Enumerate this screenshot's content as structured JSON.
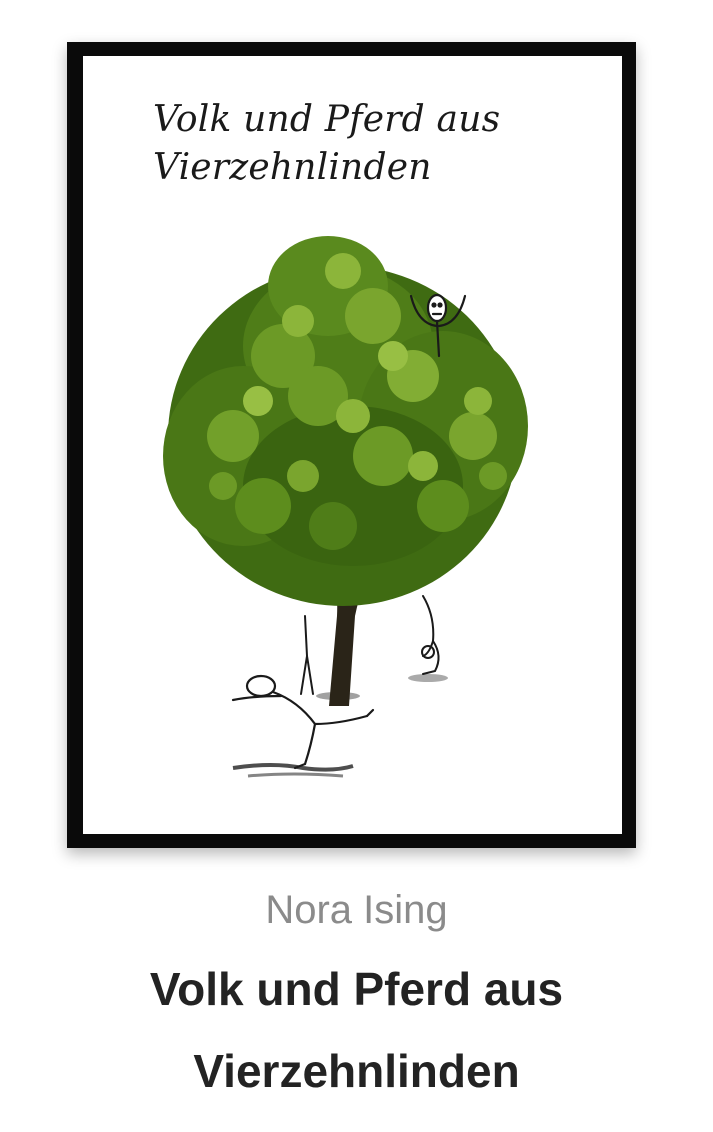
{
  "book": {
    "cover_title": "Volk und Pferd aus Vierzehnlinden",
    "author": "Nora Ising",
    "title": "Volk und Pferd aus Vierzehnlinden"
  },
  "colors": {
    "frame": "#0a0a0a",
    "author_text": "#8b8b8b",
    "title_text": "#232323",
    "foliage_dark": "#3f6b12",
    "foliage_mid": "#5d8d1d",
    "foliage_light": "#8cb53a"
  },
  "icons": {
    "cover_art": "tree-with-stick-figures-illustration"
  }
}
